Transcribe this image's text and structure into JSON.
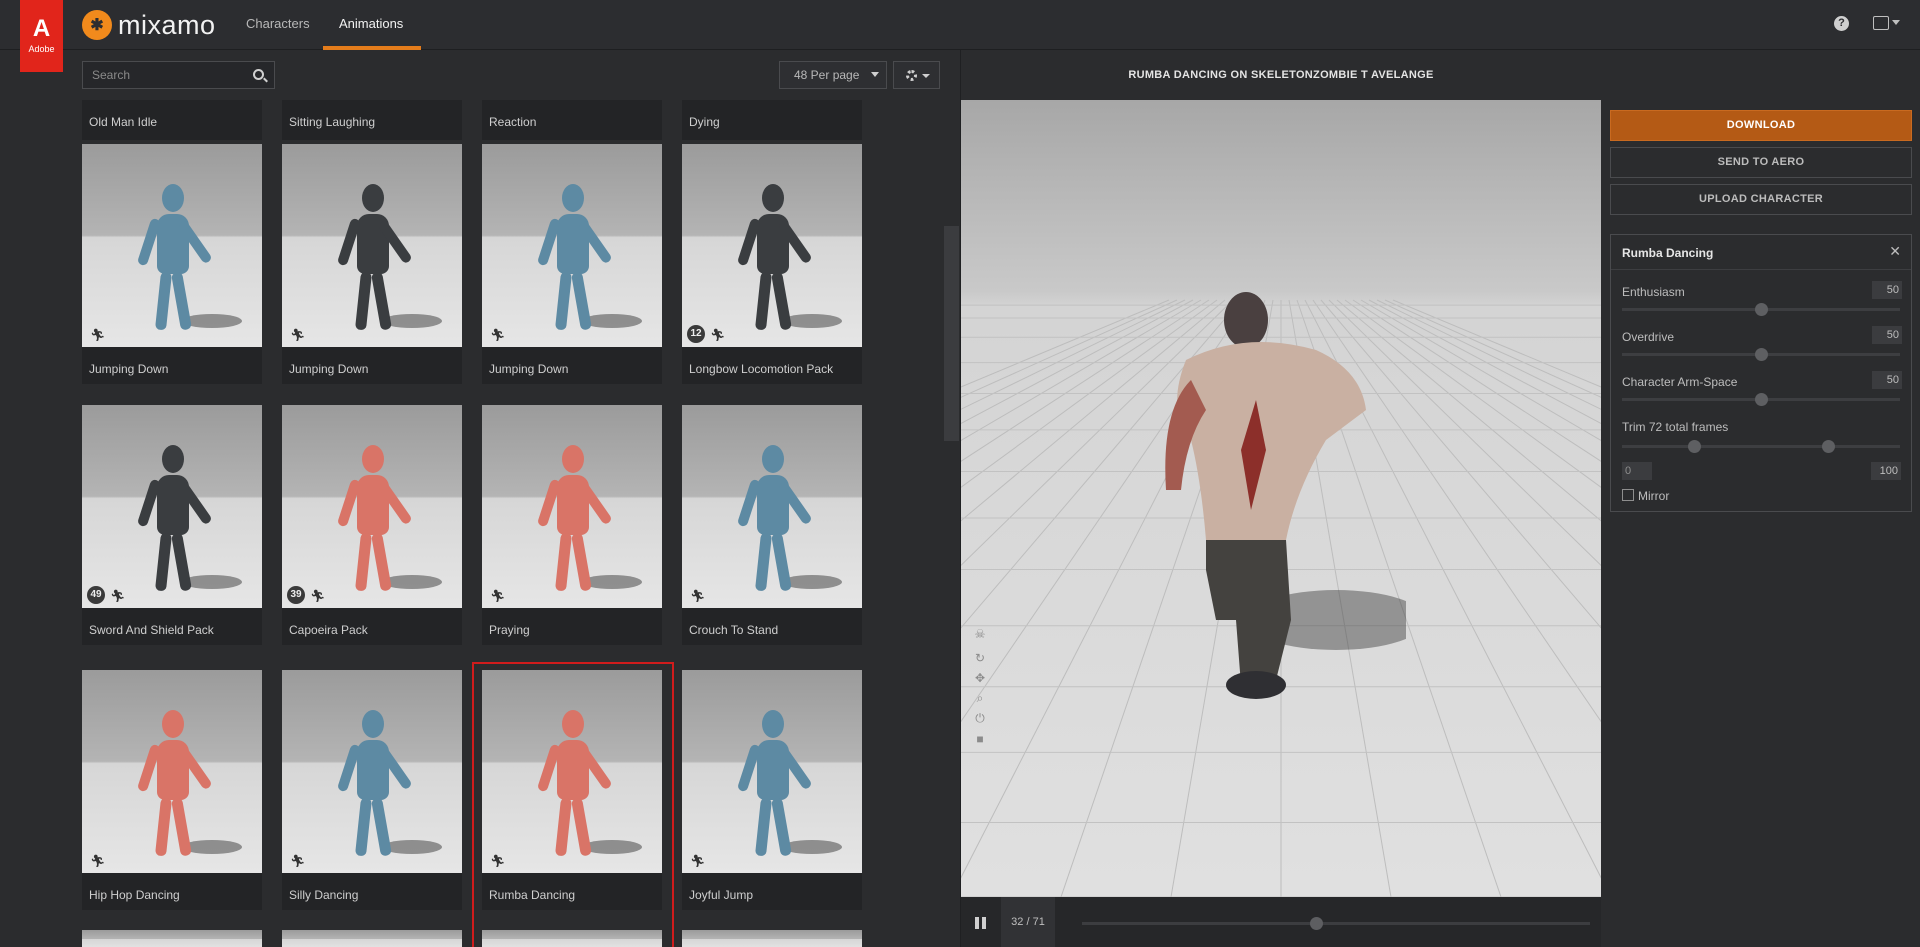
{
  "header": {
    "adobe_logo": "A",
    "adobe_text": "Adobe",
    "brand_name": "mixamo",
    "tabs": [
      {
        "label": "Characters",
        "active": false
      },
      {
        "label": "Animations",
        "active": true
      }
    ],
    "help_icon": "?",
    "accent_color": "#e47c1b"
  },
  "library": {
    "search_placeholder": "Search",
    "per_page": "48 Per page",
    "top_row_labels": [
      "Old Man Idle",
      "Sitting Laughing",
      "Reaction",
      "Dying"
    ],
    "cards": [
      {
        "label": "Jumping Down",
        "style": "blue",
        "count": ""
      },
      {
        "label": "Jumping Down",
        "style": "dark",
        "count": ""
      },
      {
        "label": "Jumping Down",
        "style": "blue",
        "count": ""
      },
      {
        "label": "Longbow Locomotion Pack",
        "style": "dark",
        "count": "12"
      },
      {
        "label": "Sword And Shield Pack",
        "style": "dark",
        "count": "49"
      },
      {
        "label": "Capoeira Pack",
        "style": "red",
        "count": "39"
      },
      {
        "label": "Praying",
        "style": "red",
        "count": ""
      },
      {
        "label": "Crouch To Stand",
        "style": "blue",
        "count": ""
      },
      {
        "label": "Hip Hop Dancing",
        "style": "red",
        "count": ""
      },
      {
        "label": "Silly Dancing",
        "style": "blue",
        "count": ""
      },
      {
        "label": "Rumba Dancing",
        "style": "red",
        "count": "",
        "selected": true
      },
      {
        "label": "Joyful Jump",
        "style": "blue",
        "count": ""
      }
    ]
  },
  "preview": {
    "title": "RUMBA DANCING ON SKELETONZOMBIE T AVELANGE",
    "frame_counter": "32 / 71",
    "timeline_progress": 0.46,
    "viewport_icons": [
      "skull-icon",
      "orbit-icon",
      "move-icon",
      "zoom-icon",
      "power-icon",
      "camera-icon"
    ]
  },
  "actions": {
    "download": "DOWNLOAD",
    "send_to_aero": "SEND TO AERO",
    "upload_character": "UPLOAD CHARACTER",
    "download_color": "#b45a15"
  },
  "animation_panel": {
    "title": "Rumba Dancing",
    "close_icon": "✕",
    "params": [
      {
        "label": "Enthusiasm",
        "value": "50",
        "fraction": 0.5
      },
      {
        "label": "Overdrive",
        "value": "50",
        "fraction": 0.5
      },
      {
        "label": "Character Arm-Space",
        "value": "50",
        "fraction": 0.5
      }
    ],
    "trim_label": "Trim  72 total frames",
    "trim_start": "0",
    "trim_end": "100",
    "trim_range": [
      0.26,
      0.74
    ],
    "mirror_label": "Mirror",
    "mirror_checked": false
  }
}
